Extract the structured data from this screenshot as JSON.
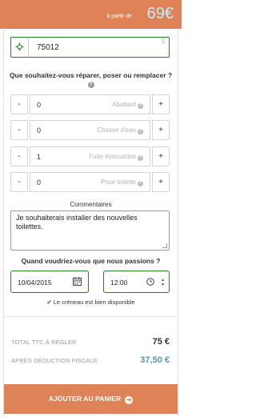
{
  "header": {
    "price_prefix": "à partir de",
    "price": "69€"
  },
  "location": {
    "postal_code": "75012",
    "icon": "locate-crosshair-icon"
  },
  "services": {
    "question": "Que souhaitez-vous réparer, poser ou remplacer ?",
    "help_icon": "?",
    "minus_label": "-",
    "plus_label": "+",
    "items": [
      {
        "label": "Abattant",
        "quantity": "0"
      },
      {
        "label": "Chasse d'eau",
        "quantity": "0"
      },
      {
        "label": "Fuite évacuation",
        "quantity": "1"
      },
      {
        "label": "Pose toilette",
        "quantity": "0"
      }
    ]
  },
  "comments": {
    "label": "Commentaires",
    "value": "Je souhaiterais installer des nouvelles toilettes."
  },
  "schedule": {
    "question": "Quand voudriez-vous que nous passions ?",
    "date": "10/04/2015",
    "time": "12:00",
    "availability": "Le créneau est bien disponible"
  },
  "totals": {
    "total_label": "TOTAL TTC À RÉGLER",
    "total_value": "75 €",
    "after_tax_label": "APRÈS DÉDUCTION FISCALE",
    "after_tax_value": "37,50 €"
  },
  "cart": {
    "button_label": "AJOUTER AU PANIER"
  },
  "colors": {
    "accent": "#e08257",
    "field_border": "#2e7a2e",
    "price_highlight": "#bfeff6",
    "teal_value": "#4f9aa5"
  }
}
